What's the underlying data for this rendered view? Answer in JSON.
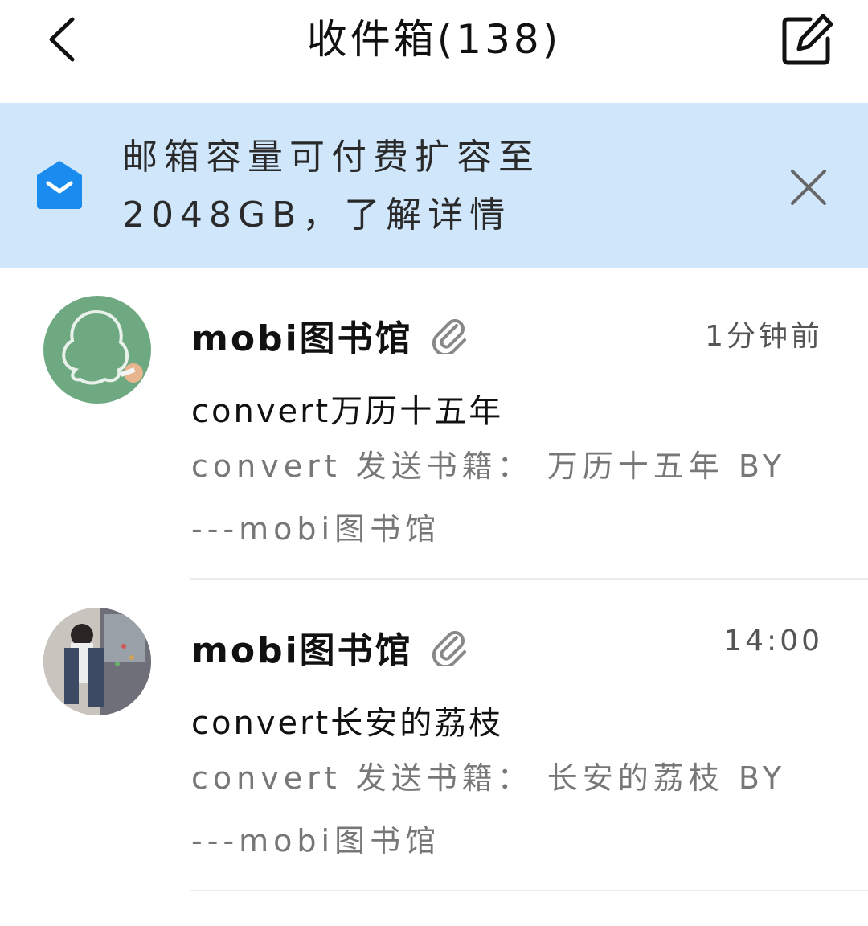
{
  "header": {
    "title": "收件箱(138)",
    "back_icon": "chevron-left-icon",
    "compose_icon": "compose-edit-icon"
  },
  "banner": {
    "text": "邮箱容量可付费扩容至2048GB，了解详情",
    "icon": "mail-open-icon",
    "close_icon": "close-icon",
    "accent": "#1a8cf0",
    "background": "#cfe6fb"
  },
  "mails": [
    {
      "sender": "mobi图书馆",
      "time": "1分钟前",
      "subject": "convert万历十五年",
      "preview": "convert 发送书籍： 万历十五年 BY ---mobi图书馆",
      "has_attachment": true
    },
    {
      "sender": "mobi图书馆",
      "time": "14:00",
      "subject": "convert长安的荔枝",
      "preview": "convert 发送书籍： 长安的荔枝 BY ---mobi图书馆",
      "has_attachment": true
    }
  ]
}
